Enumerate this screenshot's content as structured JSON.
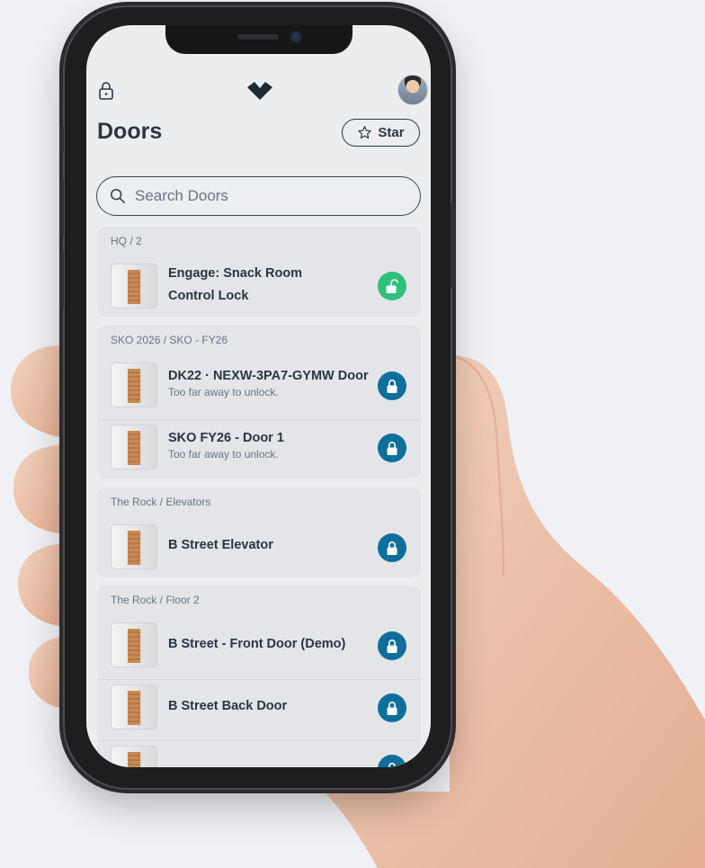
{
  "app": {
    "title": "Doors",
    "star_label": "Star",
    "search_placeholder": "Search Doors"
  },
  "colors": {
    "locked": "#0f6f9c",
    "unlocked": "#2fc17a",
    "text": "#2a3642"
  },
  "icons": [
    "lock-icon",
    "brand-logo-icon",
    "avatar",
    "star-icon",
    "search-icon",
    "door-thumbnail",
    "lock-closed-icon",
    "lock-open-icon"
  ],
  "groups": [
    {
      "label": "HQ / 2",
      "doors": [
        {
          "name_line1": "Engage: Snack Room",
          "name_line2": "Control Lock",
          "status": "unlocked"
        }
      ]
    },
    {
      "label": "SKO 2026 / SKO - FY26",
      "doors": [
        {
          "name": "DK22 · NEXW-3PA7-GYMW Door",
          "sub": "Too far away to unlock.",
          "status": "locked"
        },
        {
          "name": "SKO FY26 - Door 1",
          "sub": "Too far away to unlock.",
          "status": "locked"
        }
      ]
    },
    {
      "label": "The Rock / Elevators",
      "doors": [
        {
          "name": "B Street Elevator",
          "status": "locked"
        }
      ]
    },
    {
      "label": "The Rock / Floor 2",
      "doors": [
        {
          "name": "B Street - Front Door (Demo)",
          "status": "locked"
        },
        {
          "name": "B Street Back Door",
          "status": "locked"
        }
      ]
    }
  ]
}
